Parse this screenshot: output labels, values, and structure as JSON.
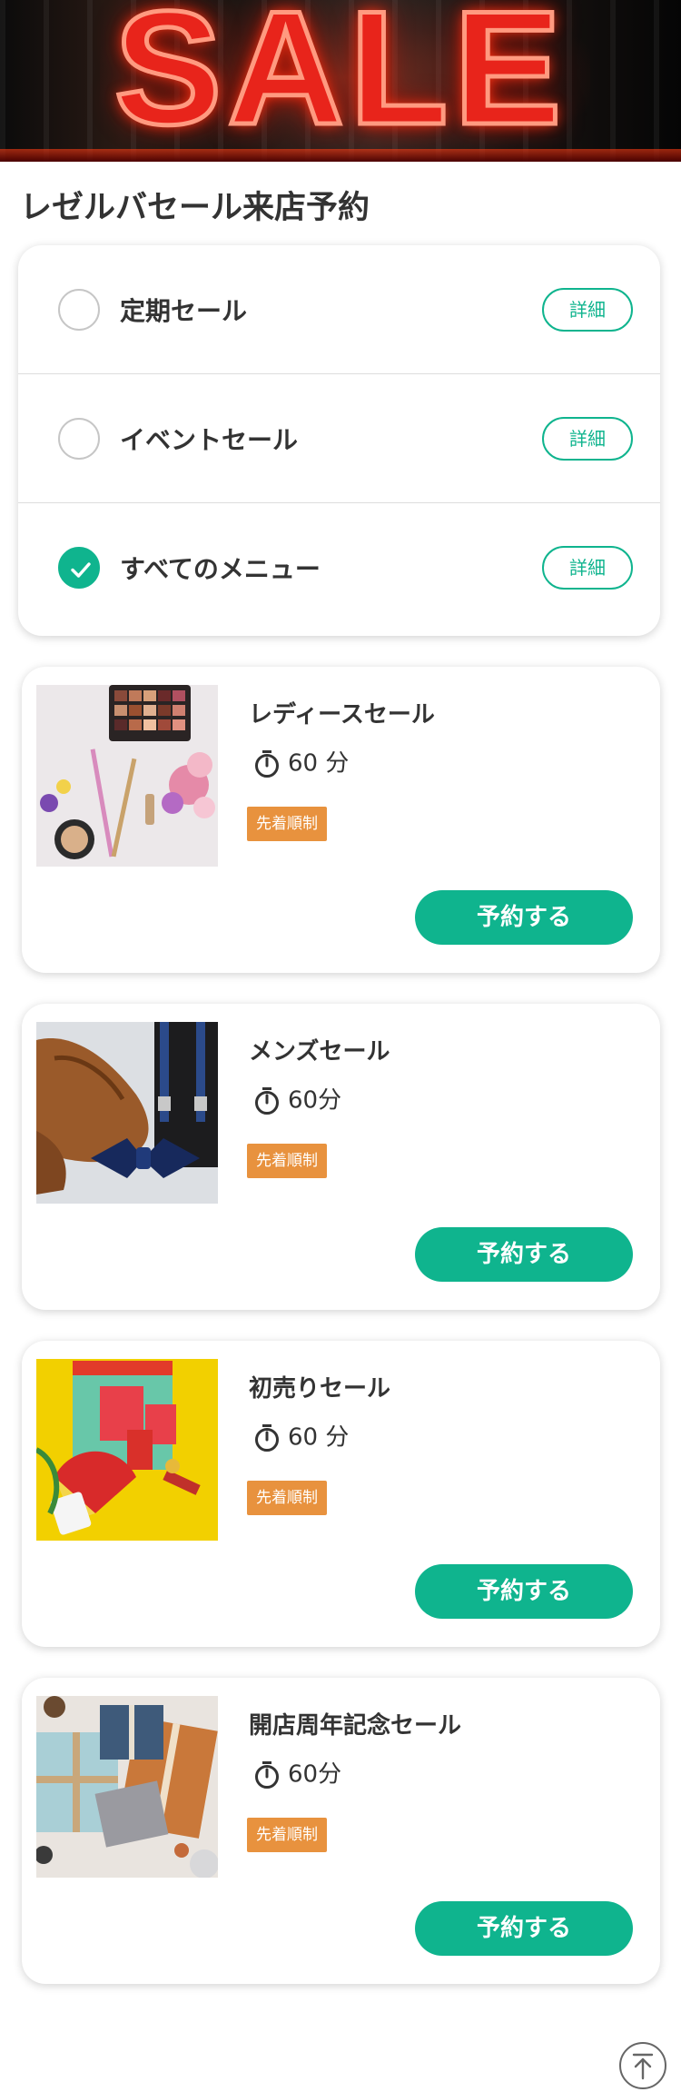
{
  "hero": {
    "banner_text": "SALE"
  },
  "page": {
    "title": "レゼルバセール来店予約"
  },
  "filters": [
    {
      "label": "定期セール",
      "detail_label": "詳細",
      "checked": false
    },
    {
      "label": "イベントセール",
      "detail_label": "詳細",
      "checked": false
    },
    {
      "label": "すべてのメニュー",
      "detail_label": "詳細",
      "checked": true
    }
  ],
  "menu_items": [
    {
      "name": "レディースセール",
      "duration": "60 分",
      "badge": "先着順制",
      "reserve_label": "予約する",
      "image": "cosmetics-photo"
    },
    {
      "name": "メンズセール",
      "duration": "60分",
      "badge": "先着順制",
      "reserve_label": "予約する",
      "image": "shoes-bowtie-photo"
    },
    {
      "name": "初売りセール",
      "duration": "60 分",
      "badge": "先着順制",
      "reserve_label": "予約する",
      "image": "lucky-bag-photo"
    },
    {
      "name": "開店周年記念セール",
      "duration": "60分",
      "badge": "先着順制",
      "reserve_label": "予約する",
      "image": "gift-boxes-photo"
    }
  ],
  "icons": {
    "timer": "stopwatch-icon",
    "check": "check-icon",
    "scroll_top": "arrow-up-icon"
  },
  "colors": {
    "accent": "#0fb48e",
    "badge": "#e8923e",
    "text": "#333333",
    "sale_red": "#e8241b"
  }
}
